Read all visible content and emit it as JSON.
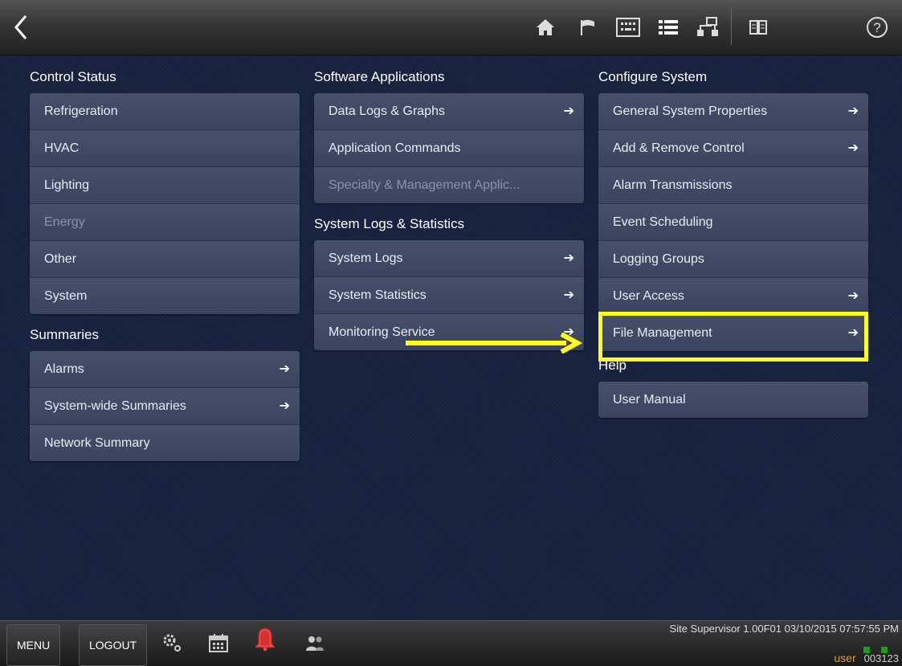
{
  "topbar": {
    "icons": [
      "back-icon",
      "home-icon",
      "flag-icon",
      "keypad-icon",
      "list-icon",
      "network-icon",
      "book-icon",
      "help-icon"
    ]
  },
  "columns": {
    "control_status": {
      "title": "Control Status",
      "items": [
        {
          "label": "Refrigeration",
          "disabled": false,
          "arrow": false
        },
        {
          "label": "HVAC",
          "disabled": false,
          "arrow": false
        },
        {
          "label": "Lighting",
          "disabled": false,
          "arrow": false
        },
        {
          "label": "Energy",
          "disabled": true,
          "arrow": false
        },
        {
          "label": "Other",
          "disabled": false,
          "arrow": false
        },
        {
          "label": "System",
          "disabled": false,
          "arrow": false
        }
      ]
    },
    "summaries": {
      "title": "Summaries",
      "items": [
        {
          "label": "Alarms",
          "arrow": true
        },
        {
          "label": "System-wide Summaries",
          "arrow": true
        },
        {
          "label": "Network Summary",
          "arrow": false
        }
      ]
    },
    "software_applications": {
      "title": "Software Applications",
      "items": [
        {
          "label": "Data Logs & Graphs",
          "arrow": true
        },
        {
          "label": "Application Commands",
          "arrow": false
        },
        {
          "label": "Specialty & Management Applic...",
          "disabled": true,
          "arrow": false
        }
      ]
    },
    "system_logs": {
      "title": "System Logs & Statistics",
      "items": [
        {
          "label": "System Logs",
          "arrow": true
        },
        {
          "label": "System Statistics",
          "arrow": true
        },
        {
          "label": "Monitoring Service",
          "arrow": true
        }
      ]
    },
    "configure_system": {
      "title": "Configure System",
      "items": [
        {
          "label": "General System Properties",
          "arrow": true
        },
        {
          "label": "Add & Remove Control",
          "arrow": true
        },
        {
          "label": "Alarm Transmissions",
          "arrow": false
        },
        {
          "label": "Event Scheduling",
          "arrow": false
        },
        {
          "label": "Logging Groups",
          "arrow": false
        },
        {
          "label": "User Access",
          "arrow": true
        },
        {
          "label": "File Management",
          "arrow": true
        }
      ]
    },
    "help": {
      "title": "Help",
      "items": [
        {
          "label": "User Manual",
          "arrow": false
        }
      ]
    }
  },
  "bottombar": {
    "menu_label": "MENU",
    "logout_label": "LOGOUT",
    "version": "Site Supervisor 1.00F01 03/10/2015 07:57:55 PM",
    "user": "user",
    "code": "003123"
  },
  "colors": {
    "highlight": "#ffff1a",
    "alarm": "#e02020",
    "status_ok": "#1aa01a"
  }
}
